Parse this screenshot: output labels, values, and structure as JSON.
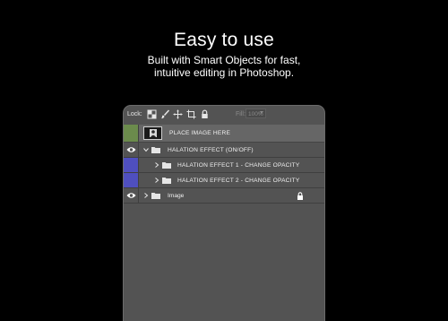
{
  "promo": {
    "headline": "Easy to use",
    "subline1": "Built with Smart Objects for fast,",
    "subline2": "intuitive editing in Photoshop."
  },
  "layers_panel": {
    "lock_label": "Lock:",
    "toolbar_icons": [
      "checkerboard-lock-icon",
      "brush-icon",
      "move-icon",
      "artboard-icon",
      "padlock-icon"
    ],
    "fill_label": "Fill:",
    "fill_value": "100%",
    "layers": [
      {
        "label": "PLACE IMAGE HERE",
        "visibility_color": "#6b8b4c",
        "thumbnail": "smart-object-thumbnail",
        "selected": true
      },
      {
        "label": "HALATION EFFECT (ON/OFF)",
        "visible": true,
        "expanded": true,
        "icon": "folder-icon"
      },
      {
        "label": "HALATION EFFECT 1 - CHANGE OPACITY",
        "visibility_color": "#4f4fbf",
        "expanded": false,
        "icon": "folder-icon"
      },
      {
        "label": "HALATION EFFECT 2 - CHANGE OPACITY",
        "visibility_color": "#4f4fbf",
        "expanded": false,
        "icon": "folder-icon"
      },
      {
        "label": "Image",
        "visible": true,
        "expanded": false,
        "icon": "folder-icon",
        "locked": true
      }
    ]
  },
  "colors": {
    "background": "#000000",
    "panel": "#535353",
    "selected_row": "#666666",
    "green_tag": "#6b8b4c",
    "blue_tag": "#4f4fbf"
  }
}
